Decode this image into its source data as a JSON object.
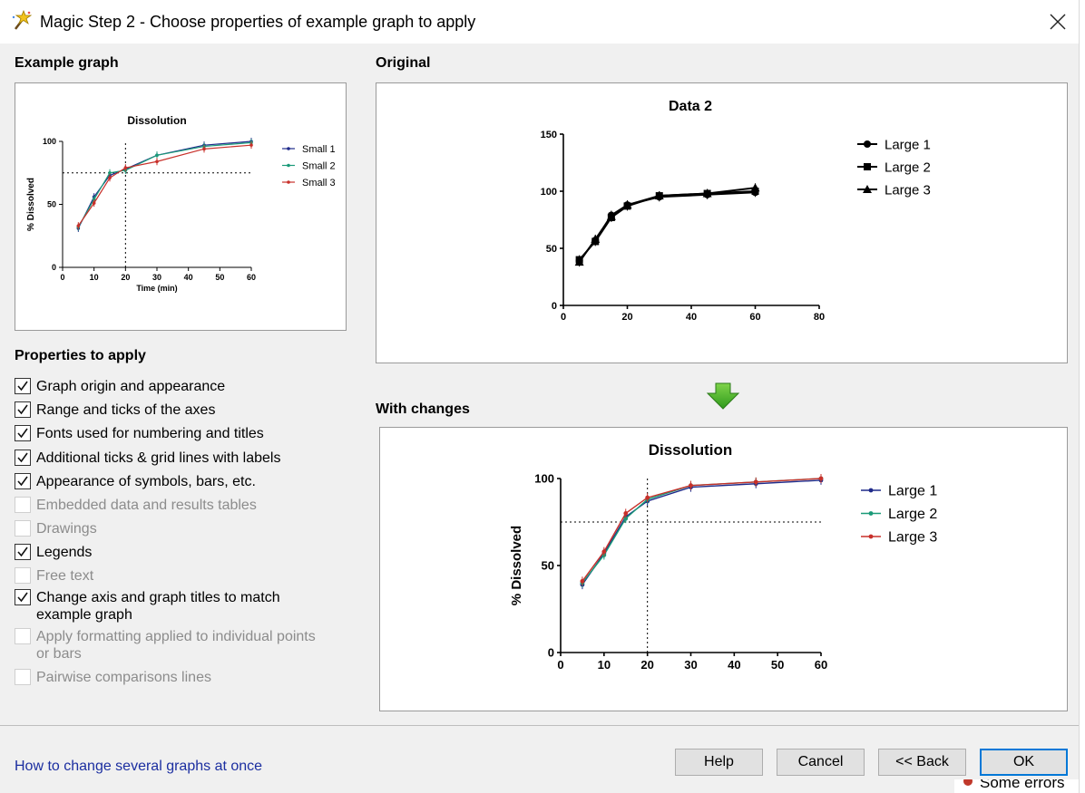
{
  "window": {
    "title": "Magic Step 2 - Choose properties of example graph to apply",
    "icon": "magic-wand-icon",
    "close_icon": "close-icon"
  },
  "example_section": {
    "label": "Example graph",
    "chart_data": {
      "type": "line",
      "title": "Dissolution",
      "xlabel": "Time (min)",
      "ylabel": "% Dissolved",
      "xlim": [
        0,
        60
      ],
      "ylim": [
        0,
        100
      ],
      "x_ticks": [
        "0",
        "10",
        "20",
        "30",
        "40",
        "50",
        "60"
      ],
      "y_ticks": [
        "0",
        "50",
        "100"
      ],
      "reference_lines": {
        "x": 20,
        "y": 75,
        "style": "dotted"
      },
      "legend_position": "right",
      "x": [
        5,
        10,
        15,
        20,
        30,
        45,
        60
      ],
      "series": [
        {
          "name": "Small 1",
          "color": "#1f2a8a",
          "values": [
            31,
            56,
            73,
            78,
            89,
            97,
            100
          ]
        },
        {
          "name": "Small 2",
          "color": "#1a9a78",
          "values": [
            32,
            54,
            75,
            77,
            89,
            96,
            99
          ]
        },
        {
          "name": "Small 3",
          "color": "#c8302a",
          "values": [
            33,
            51,
            71,
            79,
            84,
            94,
            97
          ]
        }
      ]
    }
  },
  "original_section": {
    "label": "Original",
    "chart_data": {
      "type": "line",
      "title": "Data 2",
      "xlabel": "",
      "ylabel": "",
      "xlim": [
        0,
        80
      ],
      "ylim": [
        0,
        150
      ],
      "x_ticks": [
        "0",
        "20",
        "40",
        "60",
        "80"
      ],
      "y_ticks": [
        "0",
        "50",
        "100",
        "150"
      ],
      "legend_position": "right",
      "x": [
        5,
        10,
        15,
        20,
        30,
        45,
        60
      ],
      "series": [
        {
          "name": "Large 1",
          "marker": "circle",
          "color": "#000000",
          "values": [
            39,
            57,
            79,
            88,
            95,
            97,
            99
          ]
        },
        {
          "name": "Large 2",
          "marker": "square",
          "color": "#000000",
          "values": [
            40,
            56,
            77,
            87,
            96,
            98,
            100
          ]
        },
        {
          "name": "Large 3",
          "marker": "triangle",
          "color": "#000000",
          "values": [
            38,
            58,
            78,
            88,
            96,
            98,
            103
          ]
        }
      ]
    }
  },
  "arrow_icon": "green-down-arrow-icon",
  "changes_section": {
    "label": "With changes",
    "chart_data": {
      "type": "line",
      "title": "Dissolution",
      "xlabel": "",
      "ylabel": "% Dissolved",
      "xlim": [
        0,
        60
      ],
      "ylim": [
        0,
        100
      ],
      "x_ticks": [
        "0",
        "10",
        "20",
        "30",
        "40",
        "50",
        "60"
      ],
      "y_ticks": [
        "0",
        "50",
        "100"
      ],
      "reference_lines": {
        "x": 20,
        "y": 75,
        "style": "dotted"
      },
      "legend_position": "right",
      "x": [
        5,
        10,
        15,
        20,
        30,
        45,
        60
      ],
      "series": [
        {
          "name": "Large 1",
          "color": "#1f2a8a",
          "values": [
            39,
            57,
            78,
            87,
            95,
            97,
            99
          ]
        },
        {
          "name": "Large 2",
          "color": "#1a9a78",
          "values": [
            40,
            56,
            77,
            88,
            96,
            98,
            100
          ]
        },
        {
          "name": "Large 3",
          "color": "#c8302a",
          "values": [
            41,
            58,
            80,
            89,
            96,
            98,
            100
          ]
        }
      ]
    }
  },
  "properties": {
    "label": "Properties to apply",
    "items": [
      {
        "label": "Graph origin and appearance",
        "checked": true,
        "enabled": true
      },
      {
        "label": "Range and ticks of the axes",
        "checked": true,
        "enabled": true
      },
      {
        "label": "Fonts used for numbering and titles",
        "checked": true,
        "enabled": true
      },
      {
        "label": "Additional ticks & grid lines with labels",
        "checked": true,
        "enabled": true
      },
      {
        "label": "Appearance of symbols, bars, etc.",
        "checked": true,
        "enabled": true
      },
      {
        "label": "Embedded data and results tables",
        "checked": false,
        "enabled": false
      },
      {
        "label": "Drawings",
        "checked": false,
        "enabled": false
      },
      {
        "label": "Legends",
        "checked": true,
        "enabled": true
      },
      {
        "label": "Free text",
        "checked": false,
        "enabled": false
      },
      {
        "label": "Change axis and graph titles to match example graph",
        "checked": true,
        "enabled": true
      },
      {
        "label": "Apply formatting applied to individual points or bars",
        "checked": false,
        "enabled": false
      },
      {
        "label": "Pairwise comparisons lines",
        "checked": false,
        "enabled": false
      }
    ]
  },
  "footer": {
    "help_link": "How to change several graphs at once",
    "buttons": {
      "help": "Help",
      "cancel": "Cancel",
      "back": "<< Back",
      "ok": "OK"
    }
  },
  "background_glimpse": "Some errors"
}
